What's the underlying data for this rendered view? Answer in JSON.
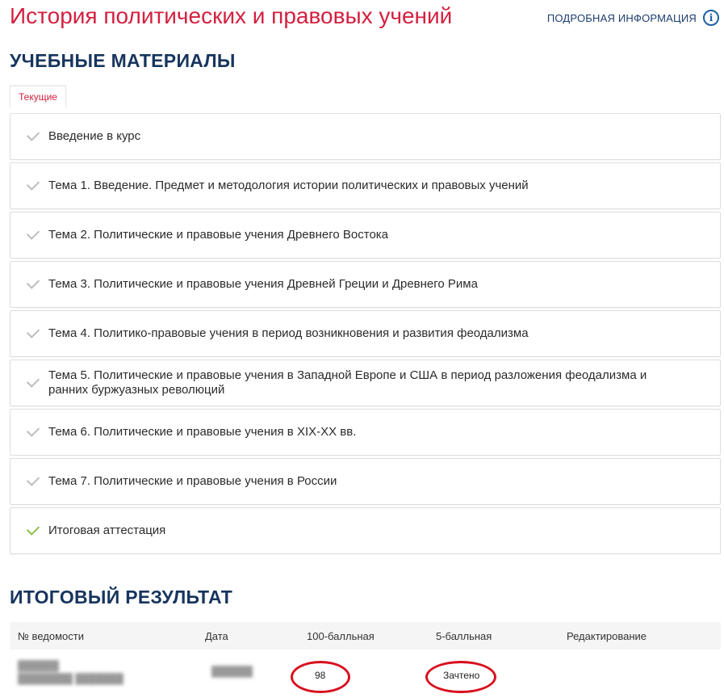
{
  "header": {
    "title": "История политических и правовых учений",
    "info_link": "ПОДРОБНАЯ ИНФОРМАЦИЯ"
  },
  "materials": {
    "heading": "УЧЕБНЫЕ МАТЕРИАЛЫ",
    "tab": "Текущие",
    "items": [
      {
        "label": "Введение в курс",
        "status": "pending"
      },
      {
        "label": "Тема 1. Введение. Предмет и методология истории политических и правовых учений",
        "status": "pending"
      },
      {
        "label": "Тема 2. Политические и правовые учения Древнего Востока",
        "status": "pending"
      },
      {
        "label": "Тема 3. Политические и правовые учения Древней Греции и Древнего Рима",
        "status": "pending"
      },
      {
        "label": "Тема 4. Политико-правовые учения в период возникновения и развития феодализма",
        "status": "pending"
      },
      {
        "label": "Тема 5. Политические и правовые учения в Западной Европе и США в период разложения феодализма и ранних буржуазных революций",
        "status": "pending"
      },
      {
        "label": "Тема 6. Политические и правовые учения в XIX-XX вв.",
        "status": "pending"
      },
      {
        "label": "Тема 7. Политические и правовые учения в России",
        "status": "pending"
      },
      {
        "label": "Итоговая аттестация",
        "status": "done"
      }
    ],
    "colors": {
      "check_pending": "#bdbdbd",
      "check_done": "#8ec24a"
    }
  },
  "result": {
    "heading": "ИТОГОВЫЙ РЕЗУЛЬТАТ",
    "columns": [
      "№ ведомости",
      "Дата",
      "100-балльная",
      "5-балльная",
      "Редактирование"
    ],
    "row": {
      "score_100": "98",
      "score_5": "Зачтено"
    }
  },
  "colors": {
    "title": "#d3203f",
    "heading": "#17355e",
    "highlight": "#d8101f"
  }
}
